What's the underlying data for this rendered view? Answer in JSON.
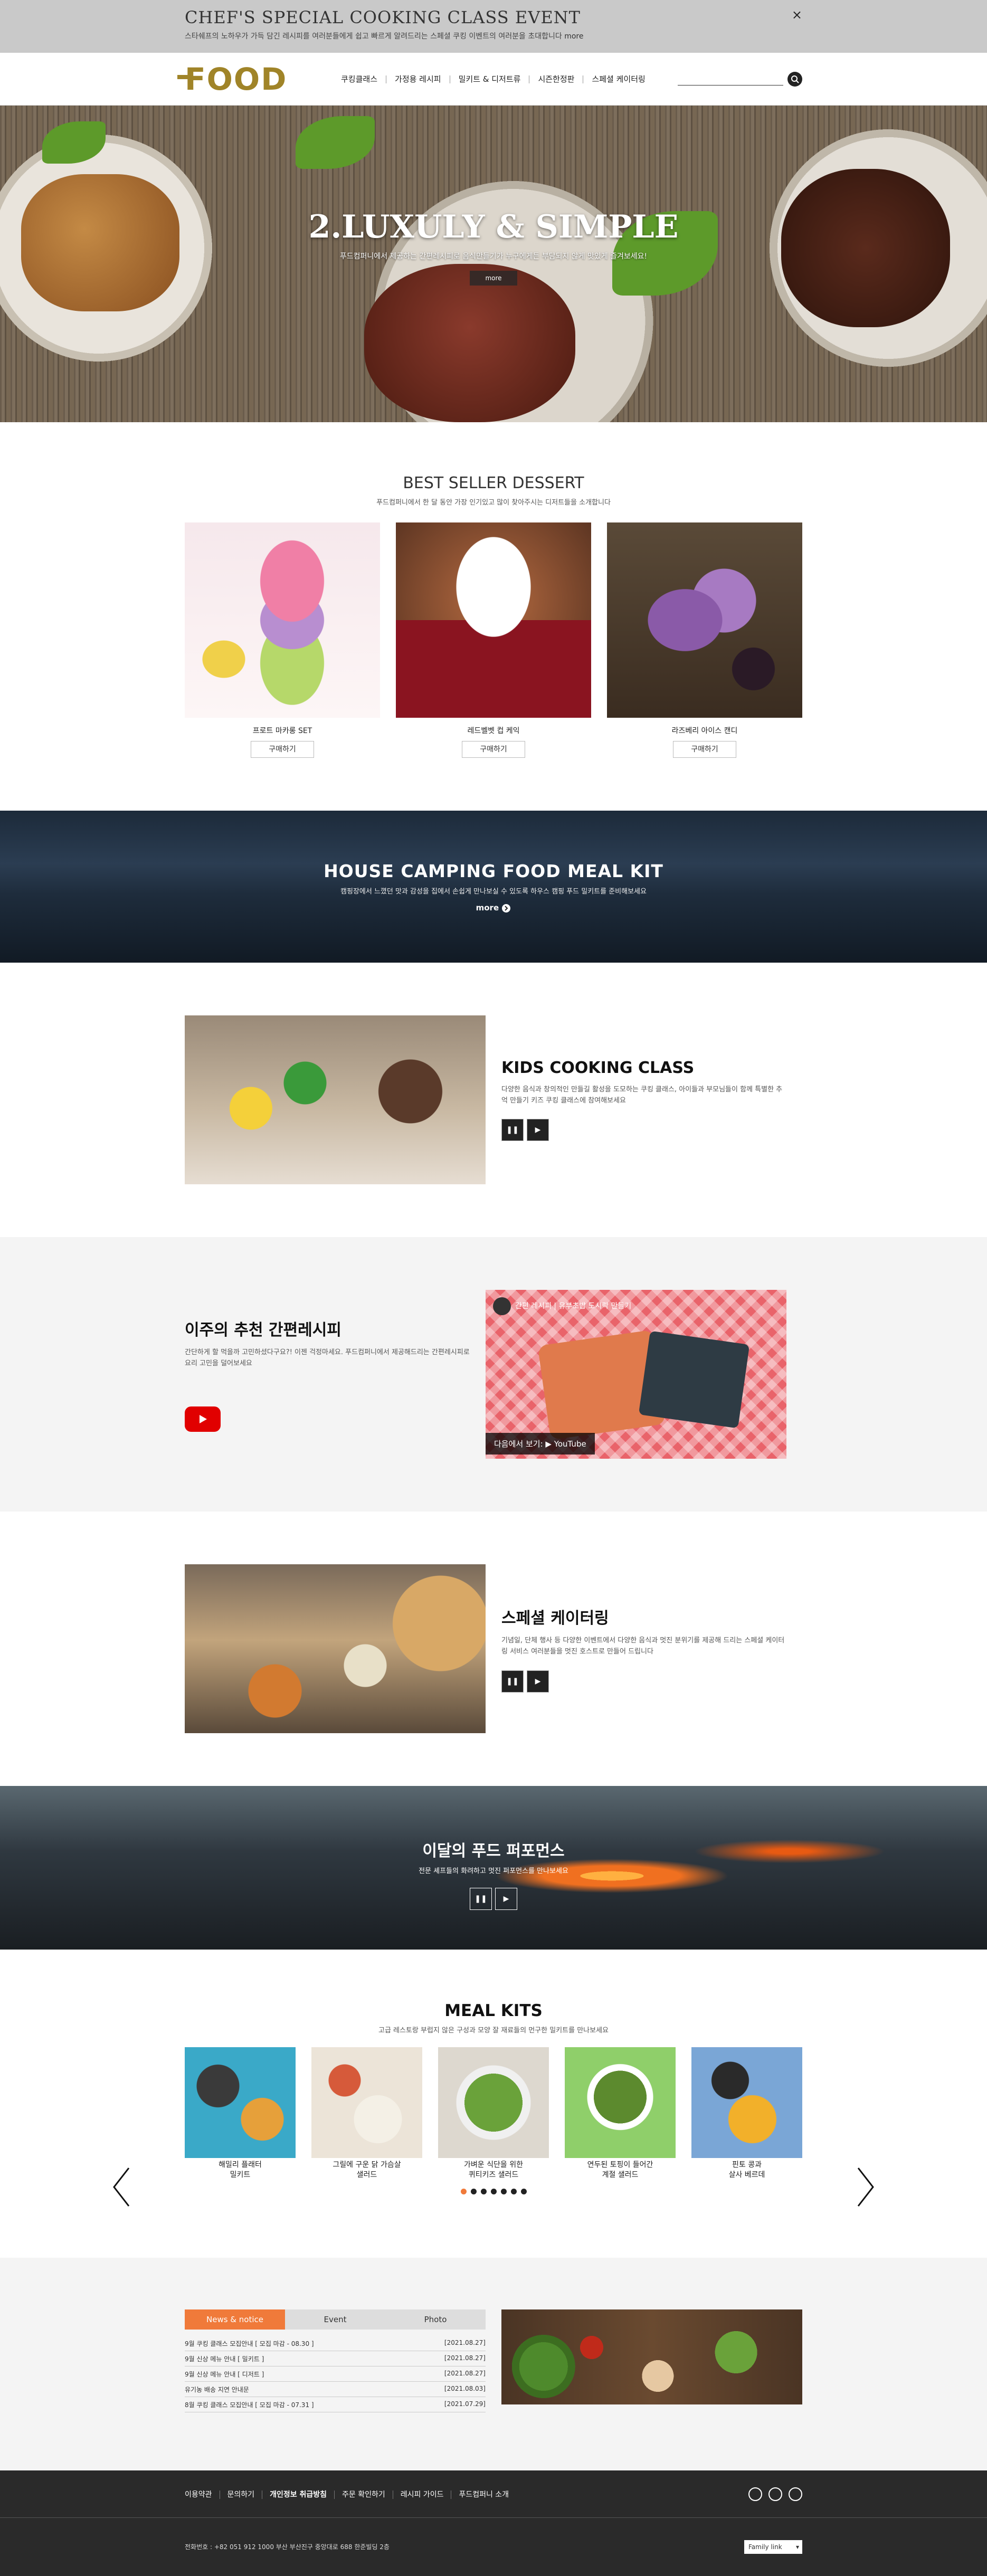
{
  "topbar": {
    "title": "CHEF'S SPECIAL COOKING CLASS EVENT",
    "desc": "스타쉐프의 노하우가 가득 담긴 레시피를 여러분들에게 쉽고 빠르게 알려드리는 스페셜 쿠킹 이벤트의 여러분을 초대합니다",
    "more": "more",
    "close": "×"
  },
  "header": {
    "logo": "FOOD",
    "nav": [
      "쿠킹클래스",
      "가정용 레시피",
      "밀키트 & 디저트류",
      "시즌한정판",
      "스페셜 케이터링"
    ],
    "search_placeholder": ""
  },
  "hero": {
    "title": "2.LUXULY & SIMPLE",
    "desc": "푸드컴퍼니에서 제공하는 간편레시피로 음식만들기가 누구에게든 부담되지 않게 맛있게 즐겨보세요!",
    "more": "more"
  },
  "best": {
    "title": "BEST SELLER DESSERT",
    "sub": "푸드컴퍼니에서 한 달 동안 가장 인기있고 많이 찾아주시는 디저트들을 소개합니다",
    "buy_label": "구매하기",
    "items": [
      {
        "name": "프로트 마카롱 SET"
      },
      {
        "name": "레드벨벳 컵 케익"
      },
      {
        "name": "라즈베리 아이스 캔디"
      }
    ]
  },
  "camping": {
    "title": "HOUSE CAMPING FOOD MEAL KIT",
    "desc": "캠핑장에서 느꼈던 맛과 감성을 집에서 손쉽게 만나보실 수 있도록 하우스 캠핑 푸드 밀키트를 준비해보세요",
    "more": "more"
  },
  "kids": {
    "title": "KIDS COOKING CLASS",
    "desc": "다양한 음식과 창의적인 만들길 활성을 도모하는 쿠킹 클래스, 아이들과 부모님들이 함께 특별한 추억 만들기 키즈 쿠킹 클래스에 참여해보세요"
  },
  "recipe": {
    "title": "이주의 추천 간편레시피",
    "desc": "간단하게 할 먹을까 고민하셨다구요?! 이젠 걱정마세요. 푸드컴퍼니에서 제공해드리는 간편레시피로 요리 고민을 덜어보세요",
    "video_title": "간편 레시피 | 유부초밥 도시락 만들기",
    "watch": "다음에서 보기: ▶ YouTube"
  },
  "catering": {
    "title": "스페셜 케이터링",
    "desc": "기념일, 단체 행사 등 다양한 이벤트에서 다양한 음식과 멋진 분위기를 제공해 드리는 스페셜 케이터링 서비스 여러분들을 멋진 호스트로 만들어 드립니다"
  },
  "perf": {
    "title": "이달의 푸드 퍼포먼스",
    "desc": "전문 셰프들의 화려하고 멋진 퍼포먼스를 만나보세요"
  },
  "meal": {
    "title": "MEAL KITS",
    "sub": "고급 레스토랑 부럽지 않은 구성과 모양 잘 재료들의 먼구한 밀키트를 만나보세요",
    "items": [
      {
        "label": "해밀리 플래터\n밀키트"
      },
      {
        "label": "그릴에 구운 닭 가슴살\n샐러드"
      },
      {
        "label": "가벼운 식단을 위한\n퀴티키즈 샐러드"
      },
      {
        "label": "연두된 토핑이 들어간\n계절 샐러드"
      },
      {
        "label": "핀토 콩과\n살사 베르데"
      }
    ]
  },
  "news": {
    "tabs": [
      "News & notice",
      "Event",
      "Photo"
    ],
    "items": [
      {
        "title": "9월 쿠킹 클래스 모집안내 [ 모집 마감 - 08.30 ]",
        "date": "[2021.08.27]"
      },
      {
        "title": "9월 신상 메뉴 안내 [ 밀키트 ]",
        "date": "[2021.08.27]"
      },
      {
        "title": "9월 신상 메뉴 안내 [ 디저트 ]",
        "date": "[2021.08.27]"
      },
      {
        "title": "유기농 배송 지연 안내문",
        "date": "[2021.08.03]"
      },
      {
        "title": "8월 쿠킹 클래스 모집안내 [ 모집 마감 - 07.31 ]",
        "date": "[2021.07.29]"
      }
    ]
  },
  "footer": {
    "links": [
      "이용약관",
      "문의하기",
      "개인정보 취급방침",
      "주문 확인하기",
      "레시피 가이드",
      "푸드컴퍼니 소개"
    ],
    "addr": "전화번호 : +82 051 912 1000 부산 부산진구 중앙대로 688 한준빌딩 2층",
    "family": "Family link"
  },
  "colors": {
    "accent": "#f07a3a",
    "logo": "#a08428"
  }
}
